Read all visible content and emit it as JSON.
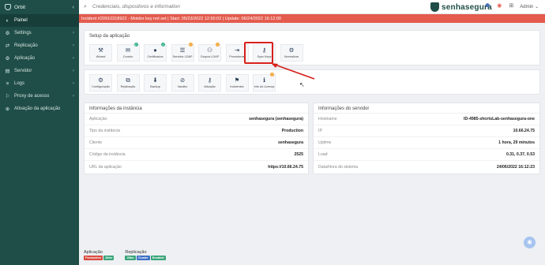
{
  "app": {
    "org_name": "Orbit",
    "brand": "senhasegura"
  },
  "sidebar": {
    "items": [
      {
        "label": "Painel",
        "icon": "dashboard-icon",
        "glyph": "◐",
        "chevron": ""
      },
      {
        "label": "Settings",
        "icon": "gear-icon",
        "glyph": "⚙",
        "chevron": "›"
      },
      {
        "label": "Replicação",
        "icon": "replication-icon",
        "glyph": "⇄",
        "chevron": "›"
      },
      {
        "label": "Aplicação",
        "icon": "application-icon",
        "glyph": "⚙",
        "chevron": "›"
      },
      {
        "label": "Servidor",
        "icon": "server-icon",
        "glyph": "▤",
        "chevron": "›"
      },
      {
        "label": "Logs",
        "icon": "logs-icon",
        "glyph": "≡",
        "chevron": "›"
      },
      {
        "label": "Proxy de acesso",
        "icon": "proxy-icon",
        "glyph": "⚐",
        "chevron": "›"
      },
      {
        "label": "Ativação da aplicação",
        "icon": "activation-icon",
        "glyph": "⊕",
        "chevron": ""
      }
    ]
  },
  "topbar": {
    "search_placeholder": "Credenciais, dispositivos e information",
    "user": "Admin",
    "user_chevron": "⌄"
  },
  "banner": {
    "text": "Incident #20910318922 - Motdor key not set | Start: 05/23/2022 12:50:02 | Update: 06/24/2022 16:12:00"
  },
  "setup": {
    "title": "Setup da aplicação",
    "tiles": [
      {
        "label": "Wizard",
        "glyph": "⚒",
        "badge": ""
      },
      {
        "label": "Correio",
        "glyph": "✉",
        "badge": "ok"
      },
      {
        "label": "Certificados",
        "glyph": "●",
        "badge": "ok"
      },
      {
        "label": "Servidor LDAP",
        "glyph": "☰",
        "badge": "warn"
      },
      {
        "label": "Grupos LDAP",
        "glyph": "⚇",
        "badge": "warn"
      },
      {
        "label": "Provedores",
        "glyph": "⇥",
        "badge": ""
      },
      {
        "label": "Sync Keys",
        "glyph": "⚷",
        "badge": ""
      },
      {
        "label": "Normalizar",
        "glyph": "⚙",
        "badge": ""
      }
    ]
  },
  "tools": {
    "tiles": [
      {
        "label": "Configuração",
        "glyph": "⚙",
        "badge": ""
      },
      {
        "label": "Replicação",
        "glyph": "⧉",
        "badge": ""
      },
      {
        "label": "Backup",
        "glyph": "⬇",
        "badge": ""
      },
      {
        "label": "Vandbo",
        "glyph": "⊘",
        "badge": ""
      },
      {
        "label": "Ativação",
        "glyph": "⚷",
        "badge": ""
      },
      {
        "label": "Incidentes",
        "glyph": "⚑",
        "badge": ""
      },
      {
        "label": "Info do Licença",
        "glyph": "ℹ",
        "badge": "warn"
      }
    ]
  },
  "instance": {
    "title": "Informações da instância",
    "rows": [
      {
        "label": "Aplicação",
        "value": "senhasegura (senhasegura)"
      },
      {
        "label": "Tipo da instância",
        "value": "Production"
      },
      {
        "label": "Cliente",
        "value": "senhasegura"
      },
      {
        "label": "Código da instância",
        "value": "2525"
      },
      {
        "label": "URL da aplicação",
        "value": "https://10.66.24.75"
      }
    ]
  },
  "server": {
    "title": "Informações do servidor",
    "rows": [
      {
        "label": "Hostname",
        "value": "ID-4985-shortsLab-senhasegura-one"
      },
      {
        "label": "IP",
        "value": "10.66.24.75"
      },
      {
        "label": "Uptime",
        "value": "1 hora, 29 minutos"
      },
      {
        "label": "Load",
        "value": "0.31, 0.37, 0.53"
      },
      {
        "label": "Data/Hora do sistema",
        "value": "24/06/2022 16:12:23"
      }
    ]
  },
  "footer": {
    "groups": [
      {
        "title": "Aplicação",
        "tags": [
          {
            "label": "Production",
            "color": "#d94a3d"
          },
          {
            "label": "Jitter",
            "color": "#3aa57a"
          }
        ]
      },
      {
        "title": "Replicação",
        "tags": [
          {
            "label": "Jitter",
            "color": "#3aa57a"
          },
          {
            "label": "Cluster",
            "color": "#3b6fc5"
          },
          {
            "label": "Enabled",
            "color": "#3aa57a"
          }
        ]
      }
    ]
  },
  "colors": {
    "sidebar": "#1f4d47",
    "banner": "#e45b4e",
    "highlight": "#d6201a",
    "brand": "#1f4d47"
  }
}
